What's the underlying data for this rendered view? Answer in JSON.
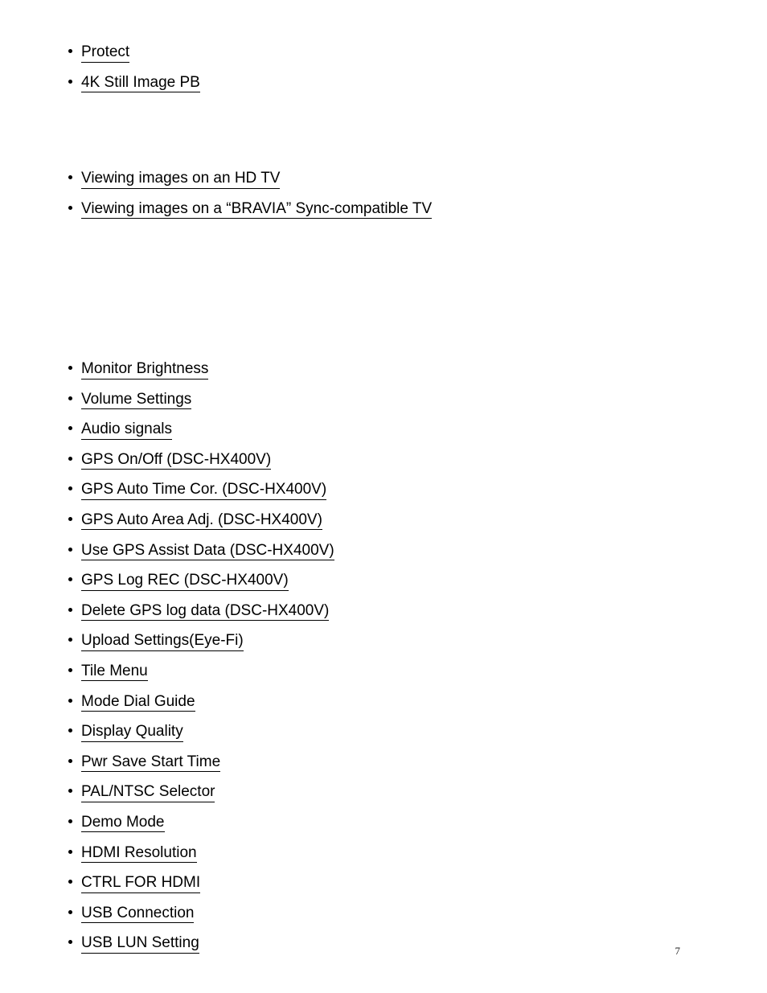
{
  "page": {
    "number": "7",
    "background_color": "#ffffff",
    "text_color": "#000000"
  },
  "groups": [
    {
      "id": "playback",
      "items": [
        {
          "label": "Protect"
        },
        {
          "label": "4K Still Image PB"
        }
      ]
    },
    {
      "id": "tv",
      "items": [
        {
          "label": "Viewing images on an HD TV"
        },
        {
          "label": "Viewing images on a “BRAVIA” Sync-compatible TV"
        }
      ]
    },
    {
      "id": "settings",
      "items": [
        {
          "label": "Monitor Brightness"
        },
        {
          "label": "Volume Settings"
        },
        {
          "label": "Audio signals"
        },
        {
          "label": "GPS On/Off (DSC-HX400V)"
        },
        {
          "label": "GPS Auto Time Cor. (DSC-HX400V)"
        },
        {
          "label": "GPS Auto Area Adj. (DSC-HX400V)"
        },
        {
          "label": "Use GPS Assist Data (DSC-HX400V)"
        },
        {
          "label": "GPS Log REC (DSC-HX400V)"
        },
        {
          "label": "Delete GPS log data (DSC-HX400V)"
        },
        {
          "label": "Upload Settings(Eye-Fi)"
        },
        {
          "label": "Tile Menu"
        },
        {
          "label": "Mode Dial Guide"
        },
        {
          "label": "Display Quality"
        },
        {
          "label": "Pwr Save Start Time"
        },
        {
          "label": "PAL/NTSC Selector"
        },
        {
          "label": "Demo Mode"
        },
        {
          "label": "HDMI Resolution"
        },
        {
          "label": "CTRL FOR HDMI"
        },
        {
          "label": "USB Connection"
        },
        {
          "label": "USB LUN Setting"
        }
      ]
    }
  ]
}
